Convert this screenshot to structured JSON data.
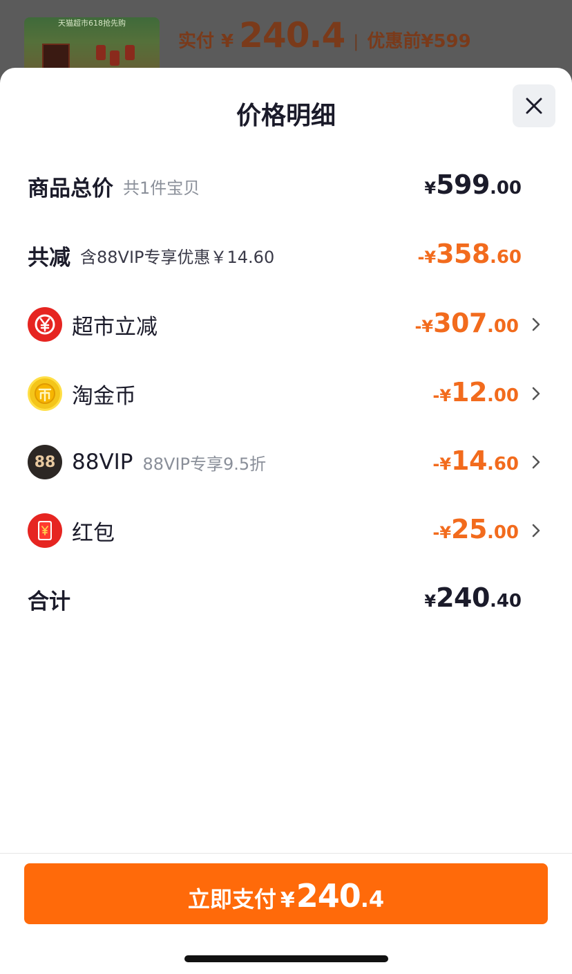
{
  "header_bar": {
    "thumb_banner": "天猫超市618抢先购",
    "paid_label": "实付",
    "paid_yen": "¥",
    "paid_amount": "240.4",
    "separator": "|",
    "original_label": "优惠前¥599"
  },
  "sheet": {
    "title": "价格明细",
    "close_icon": "close-icon"
  },
  "rows": {
    "total": {
      "label": "商品总价",
      "sub": "共1件宝贝",
      "yen": "¥",
      "int": "599",
      "dec": ".00"
    },
    "reduce": {
      "label": "共减",
      "sub": "含88VIP专享优惠￥14.60",
      "yen": "-¥",
      "int": "358",
      "dec": ".60"
    },
    "supermarket": {
      "label": "超市立减",
      "icon": "yen-refresh-icon",
      "yen": "-¥",
      "int": "307",
      "dec": ".00"
    },
    "coin": {
      "label": "淘金币",
      "icon": "gold-coin-icon",
      "yen": "-¥",
      "int": "12",
      "dec": ".00"
    },
    "vip": {
      "label": "88VIP",
      "sub": "88VIP专享9.5折",
      "icon": "88vip-icon",
      "icon_text": "88",
      "yen": "-¥",
      "int": "14",
      "dec": ".60"
    },
    "redpacket": {
      "label": "红包",
      "icon": "red-packet-icon",
      "yen": "-¥",
      "int": "25",
      "dec": ".00"
    },
    "sum": {
      "label": "合计",
      "yen": "¥",
      "int": "240",
      "dec": ".40"
    }
  },
  "pay_button": {
    "label": "立即支付",
    "yen": "¥",
    "int": "240",
    "dec": ".4"
  },
  "colors": {
    "accent": "#ff6a0a",
    "discount": "#f26b1d",
    "text": "#1b1b2a",
    "muted": "#8a8f99"
  }
}
